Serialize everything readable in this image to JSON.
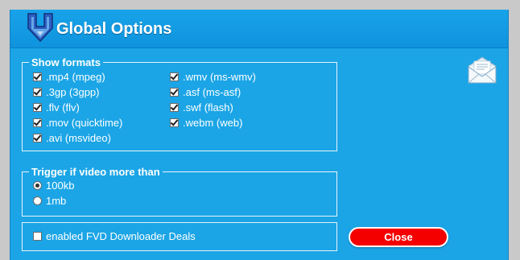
{
  "window": {
    "title": "Global Options"
  },
  "formats": {
    "legend": "Show formats",
    "items": [
      {
        "label": ".mp4 (mpeg)",
        "checked": true
      },
      {
        "label": ".3gp (3gpp)",
        "checked": true
      },
      {
        "label": ".flv (flv)",
        "checked": true
      },
      {
        "label": ".mov (quicktime)",
        "checked": true
      },
      {
        "label": ".avi (msvideo)",
        "checked": true
      },
      {
        "label": ".wmv (ms-wmv)",
        "checked": true
      },
      {
        "label": ".asf (ms-asf)",
        "checked": true
      },
      {
        "label": ".swf (flash)",
        "checked": true
      },
      {
        "label": ".webm (web)",
        "checked": true
      }
    ]
  },
  "trigger": {
    "legend": "Trigger if video more than",
    "options": [
      {
        "label": "100kb",
        "selected": true
      },
      {
        "label": "1mb",
        "selected": false
      }
    ]
  },
  "deals": {
    "label": "enabled FVD Downloader Deals",
    "checked": false
  },
  "close_button": {
    "label": "Close"
  },
  "colors": {
    "background": "#1ba5e6",
    "close_button": "#f40000",
    "text": "#ffffff"
  },
  "icons": {
    "logo": "download-arrow-icon",
    "feedback": "envelope-icon"
  }
}
